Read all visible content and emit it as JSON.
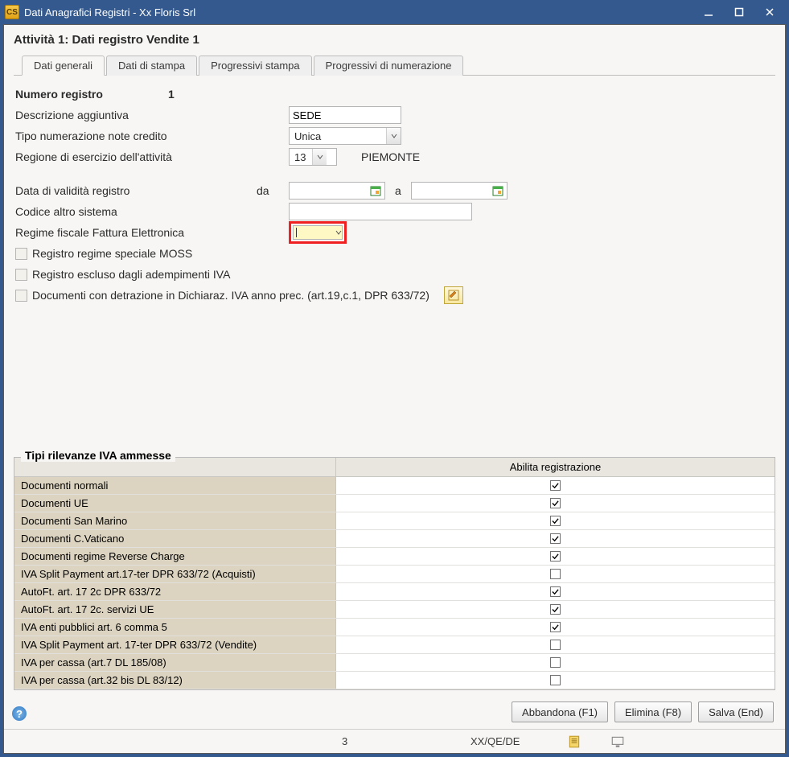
{
  "window": {
    "title": "Dati Anagrafici Registri - Xx Floris Srl"
  },
  "header": "Attività 1: Dati registro Vendite 1",
  "tabs": [
    {
      "label": "Dati generali",
      "active": true
    },
    {
      "label": "Dati di stampa",
      "active": false
    },
    {
      "label": "Progressivi stampa",
      "active": false
    },
    {
      "label": "Progressivi di numerazione",
      "active": false
    }
  ],
  "form": {
    "numero_registro_label": "Numero registro",
    "numero_registro_value": "1",
    "descrizione_label": "Descrizione aggiuntiva",
    "descrizione_value": "SEDE",
    "tipo_num_label": "Tipo numerazione note credito",
    "tipo_num_value": "Unica",
    "regione_label": "Regione di esercizio dell'attività",
    "regione_code": "13",
    "regione_name": "PIEMONTE",
    "data_validita_label": "Data di validità registro",
    "da_label": "da",
    "a_label": "a",
    "codice_sistema_label": "Codice altro sistema",
    "codice_sistema_value": "",
    "regime_fiscale_label": "Regime fiscale Fattura Elettronica",
    "regime_fiscale_value": "",
    "chk_moss_label": "Registro regime speciale MOSS",
    "chk_escluso_label": "Registro escluso dagli adempimenti IVA",
    "chk_detrazione_label": "Documenti con detrazione in Dichiaraz. IVA anno prec. (art.19,c.1, DPR 633/72)"
  },
  "grid": {
    "title": "Tipi rilevanze IVA ammesse",
    "header_col1": "",
    "header_col2": "Abilita registrazione",
    "rows": [
      {
        "label": "Documenti normali",
        "checked": true
      },
      {
        "label": "Documenti UE",
        "checked": true
      },
      {
        "label": "Documenti San Marino",
        "checked": true
      },
      {
        "label": "Documenti C.Vaticano",
        "checked": true
      },
      {
        "label": "Documenti regime Reverse Charge",
        "checked": true
      },
      {
        "label": "IVA Split Payment art.17-ter DPR 633/72 (Acquisti)",
        "checked": false
      },
      {
        "label": "AutoFt. art. 17 2c DPR 633/72",
        "checked": true
      },
      {
        "label": "AutoFt. art. 17 2c. servizi UE",
        "checked": true
      },
      {
        "label": "IVA enti pubblici art. 6 comma 5",
        "checked": true
      },
      {
        "label": "IVA Split Payment art. 17-ter DPR 633/72 (Vendite)",
        "checked": false
      },
      {
        "label": "IVA per cassa (art.7 DL 185/08)",
        "checked": false
      },
      {
        "label": "IVA per cassa (art.32 bis DL 83/12)",
        "checked": false
      }
    ]
  },
  "buttons": {
    "abbandona": "Abbandona (F1)",
    "elimina": "Elimina (F8)",
    "salva": "Salva (End)"
  },
  "statusbar": {
    "num": "3",
    "code": "XX/QE/DE"
  }
}
